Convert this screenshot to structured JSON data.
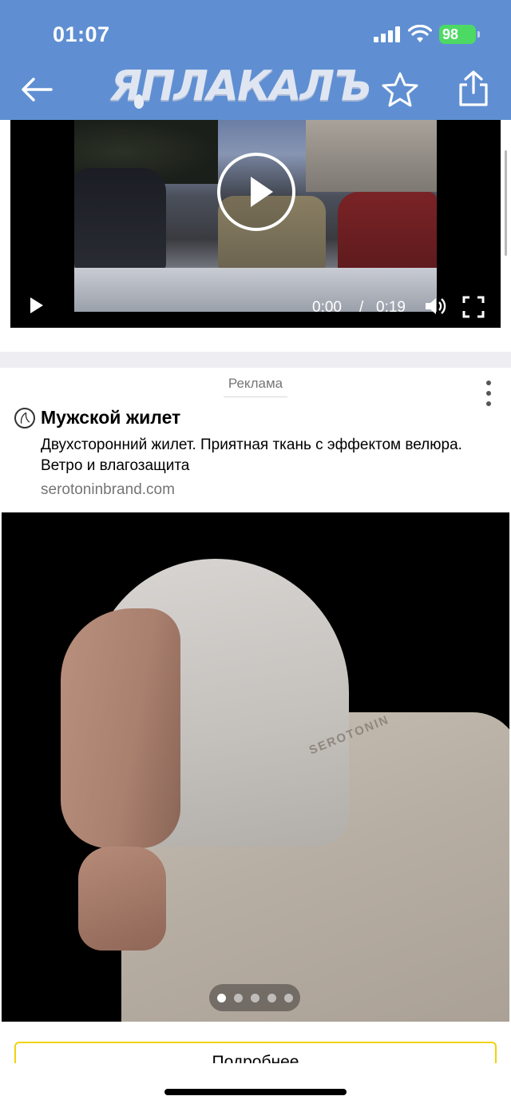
{
  "status_bar": {
    "time": "01:07",
    "battery": "98"
  },
  "header": {
    "title": "ЯПЛАКАЛЪ",
    "icons": [
      "back-arrow-icon",
      "star-icon",
      "share-icon"
    ],
    "background": "#5f8fd2"
  },
  "video": {
    "current_time": "0:00",
    "separator": "/",
    "duration": "0:19",
    "icons": [
      "play-icon",
      "volume-icon",
      "fullscreen-icon"
    ]
  },
  "ad": {
    "label": "Реклама",
    "title": "Мужской жилет",
    "description": "Двухсторонний жилет. Приятная ткань с эффектом велюра. Ветро и влагозащита",
    "domain": "serotoninbrand.com",
    "image_brand_print": "SEROTONIN",
    "carousel": {
      "count": 5,
      "active": 1
    },
    "button_label": "Подробнее",
    "button_border_color": "#f0d30a"
  }
}
